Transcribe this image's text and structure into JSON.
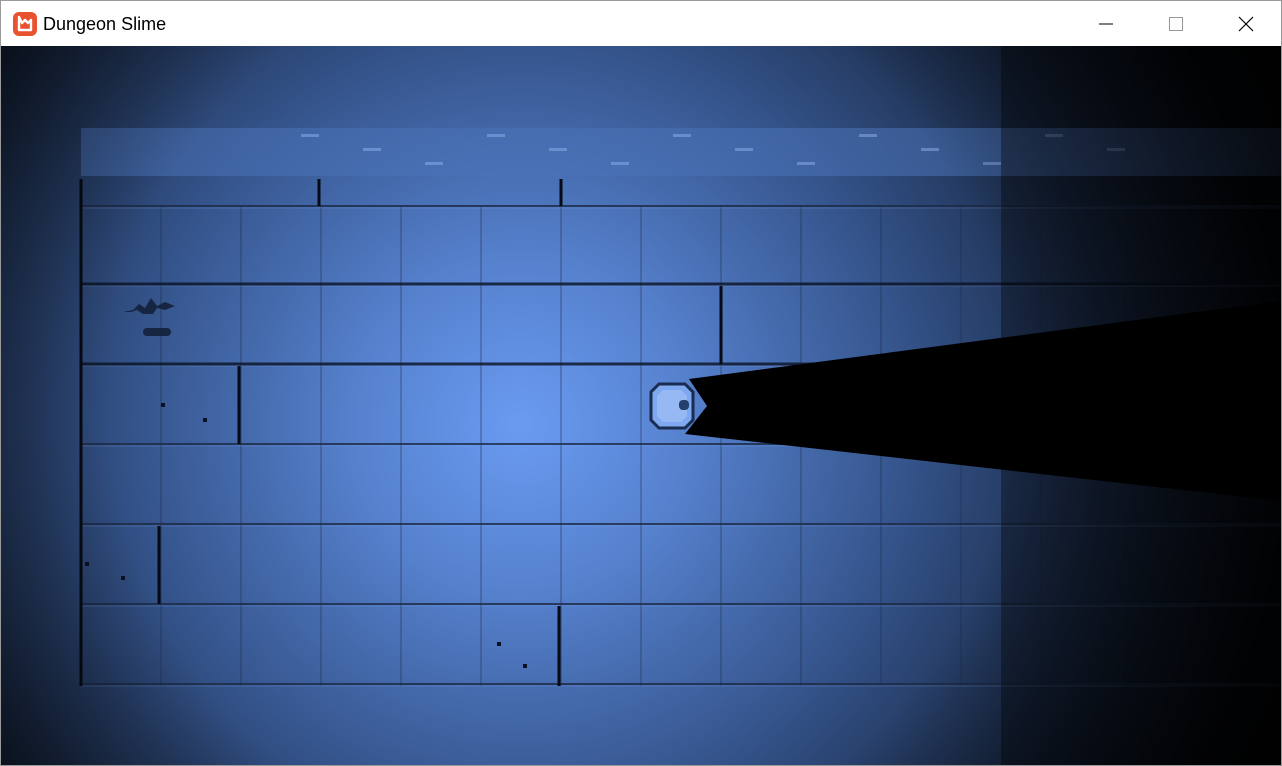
{
  "window": {
    "title": "Dungeon Slime",
    "controls": [
      {
        "name": "minimize-button",
        "icon": "minimize-icon"
      },
      {
        "name": "maximize-button",
        "icon": "maximize-icon"
      },
      {
        "name": "close-button",
        "icon": "close-icon"
      }
    ]
  },
  "app_icon": {
    "icon": "monogame-logo-icon",
    "color": "#e7522f"
  },
  "game": {
    "scene": "dungeon",
    "colors": {
      "light_center": "#6a9bf2",
      "light_mid": "#3a5a94",
      "light_edge": "#1a2844",
      "shadow": "#000000",
      "tile_line": "#1c2a44",
      "tile_highlight": "#7fa7ef"
    },
    "entities": [
      {
        "name": "slime",
        "icon": "slime-icon"
      },
      {
        "name": "bat",
        "icon": "bat-icon"
      }
    ]
  }
}
